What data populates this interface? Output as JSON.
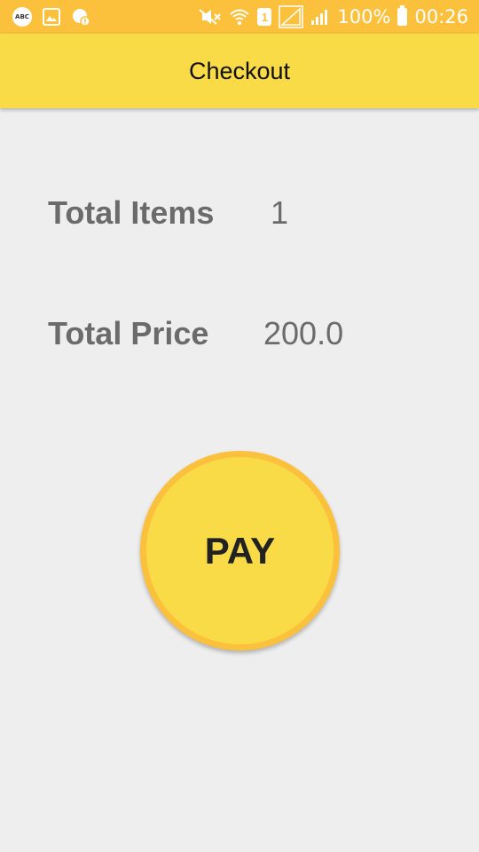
{
  "status_bar": {
    "notification_icons": [
      "keyboard-abc-icon",
      "image-icon",
      "messenger-icon"
    ],
    "keyboard_badge": "ABC",
    "system_icons": [
      "mute-icon",
      "wifi-icon",
      "sim-1-icon",
      "no-signal-icon",
      "signal-icon"
    ],
    "sim_label": "1",
    "battery": "100%",
    "time": "00:26",
    "color": "#fbc13c"
  },
  "app_bar": {
    "title": "Checkout",
    "color": "#f9db47"
  },
  "summary": {
    "items_label": "Total Items",
    "items_value": "1",
    "price_label": "Total Price",
    "price_value": "200.0"
  },
  "pay_button": {
    "label": "PAY",
    "fill_color": "#f9db47",
    "border_color": "#fbc13c"
  }
}
